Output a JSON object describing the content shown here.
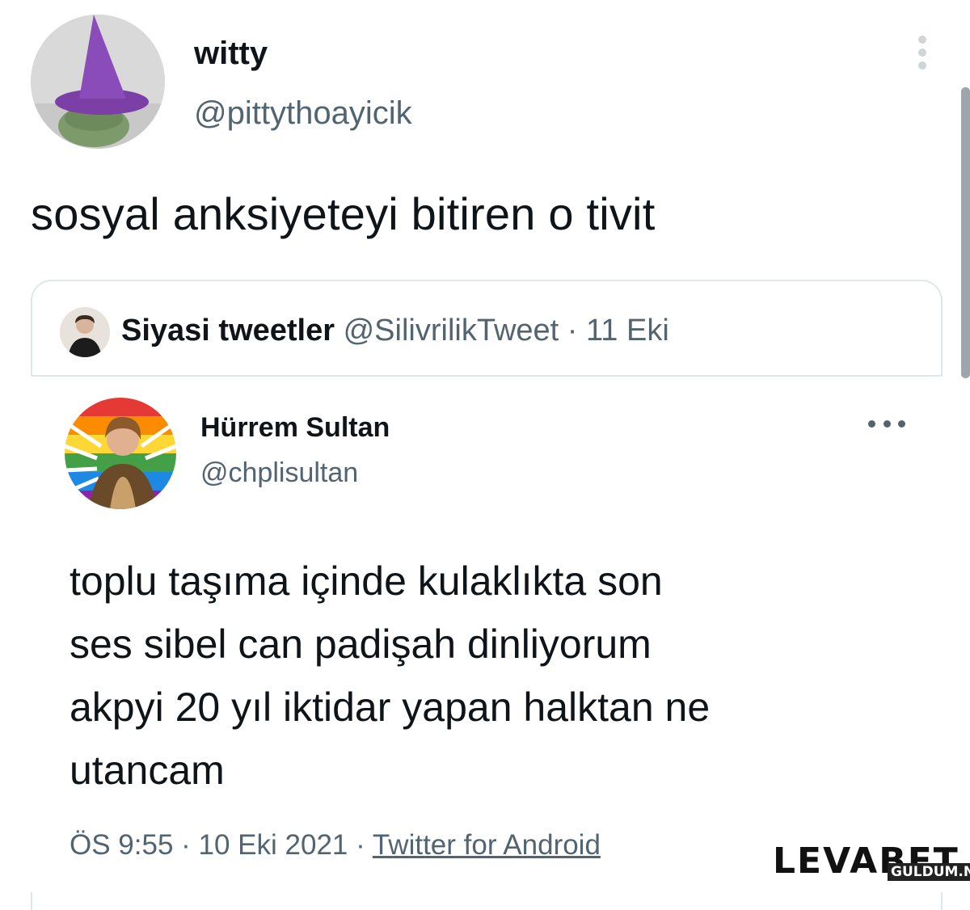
{
  "author": {
    "display_name": "witty",
    "handle": "@pittythoayicik",
    "avatar_icon": "avatar-frog-with-witch-hat"
  },
  "tweet": {
    "text": "sosyal anksiyeteyi bitiren o tivit"
  },
  "quoted": {
    "name": "Siyasi tweetler",
    "meta": "@SilivrilikTweet · 11 Eki",
    "avatar_icon": "avatar-man-portrait"
  },
  "embedded": {
    "name": "Hürrem Sultan",
    "handle": "@chplisultan",
    "avatar_icon": "avatar-rainbow-flag-woman",
    "text_lines": [
      "toplu taşıma içinde kulaklıkta son",
      "ses sibel can padişah dinliyorum",
      "akpyi 20 yıl iktidar yapan halktan ne",
      "utancam"
    ],
    "time_date": "ÖS 9:55 · 10 Eki 2021 · ",
    "source": "Twitter for Android"
  },
  "watermark": {
    "logo": "LEVABET",
    "site": "GULDUM.NET"
  },
  "colors": {
    "text": "#0f1419",
    "secondary": "#536471",
    "border": "#e1e6ea"
  }
}
